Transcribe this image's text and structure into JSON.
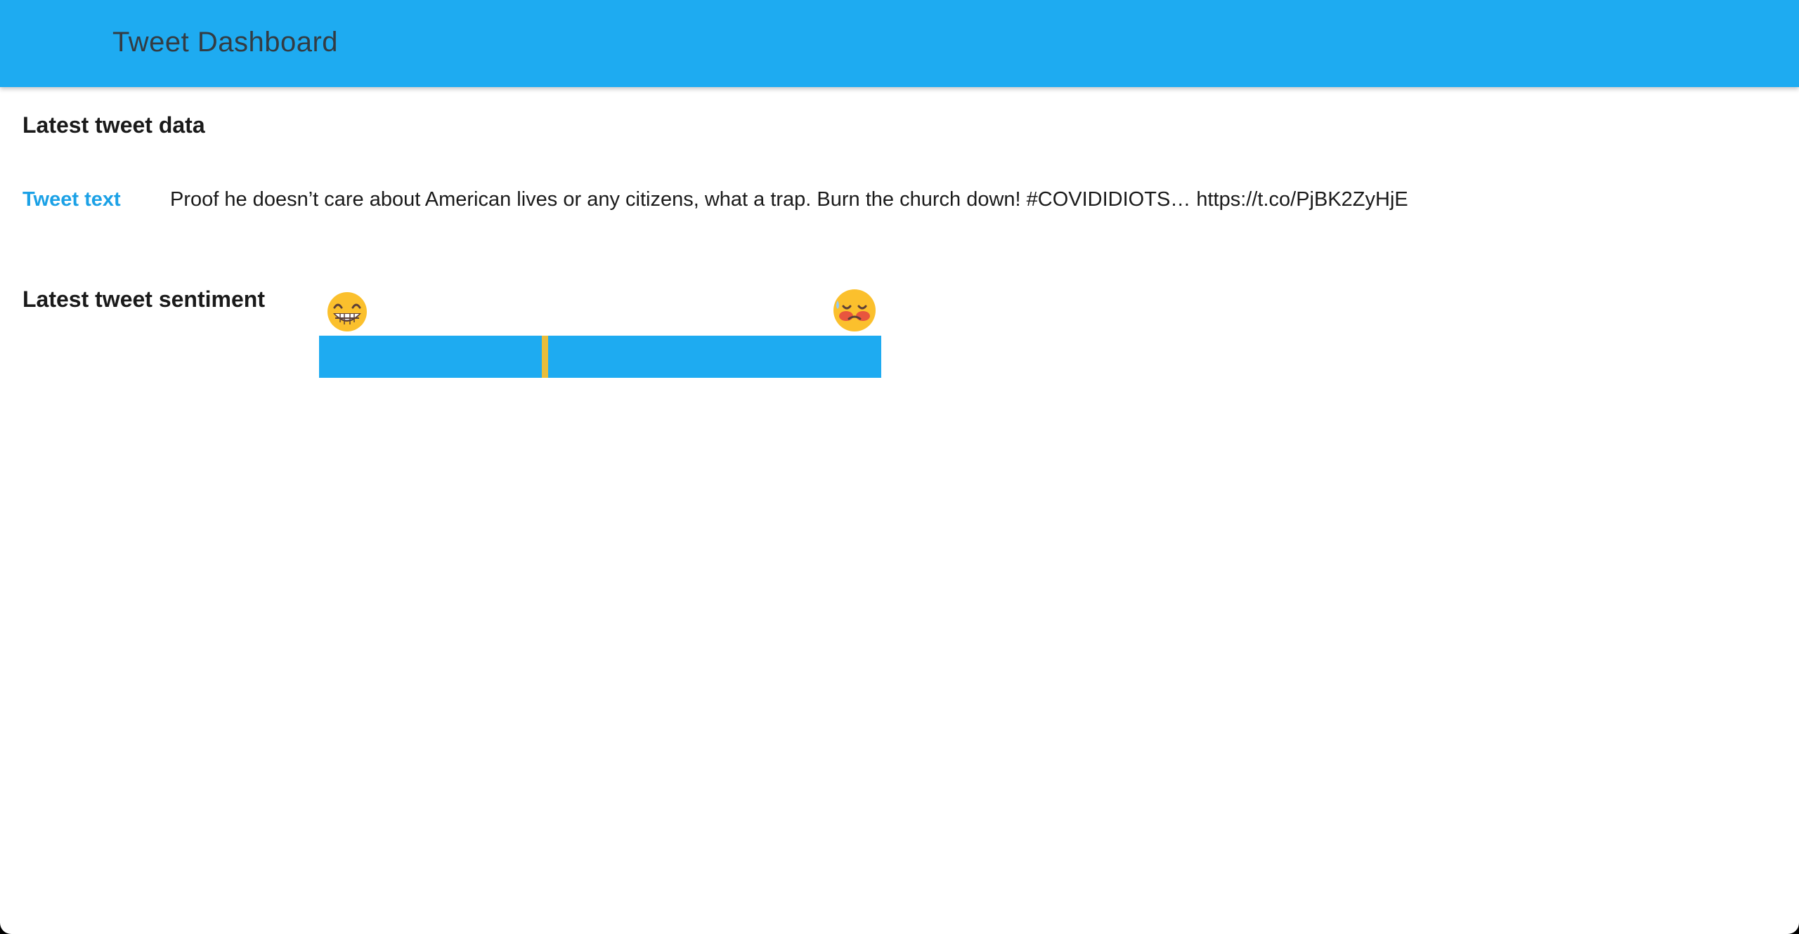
{
  "app": {
    "title": "Tweet Dashboard"
  },
  "latest_tweet_data": {
    "heading": "Latest tweet data",
    "tweet_label": "Tweet text",
    "tweet_text": "Proof he doesn’t care about American lives or any citizens, what a trap. Burn the church down! #COVIDIDIOTS… https://t.co/PjBK2ZyHjE"
  },
  "latest_tweet_sentiment": {
    "heading": "Latest tweet sentiment",
    "left_icon": "grinning-face-icon",
    "right_icon": "sad-face-icon",
    "marker_fraction": 0.402
  },
  "colors": {
    "accent": "#1eabf1",
    "label": "#1ba1e6",
    "marker": "#e8bd3c",
    "title_text": "#333c43"
  }
}
